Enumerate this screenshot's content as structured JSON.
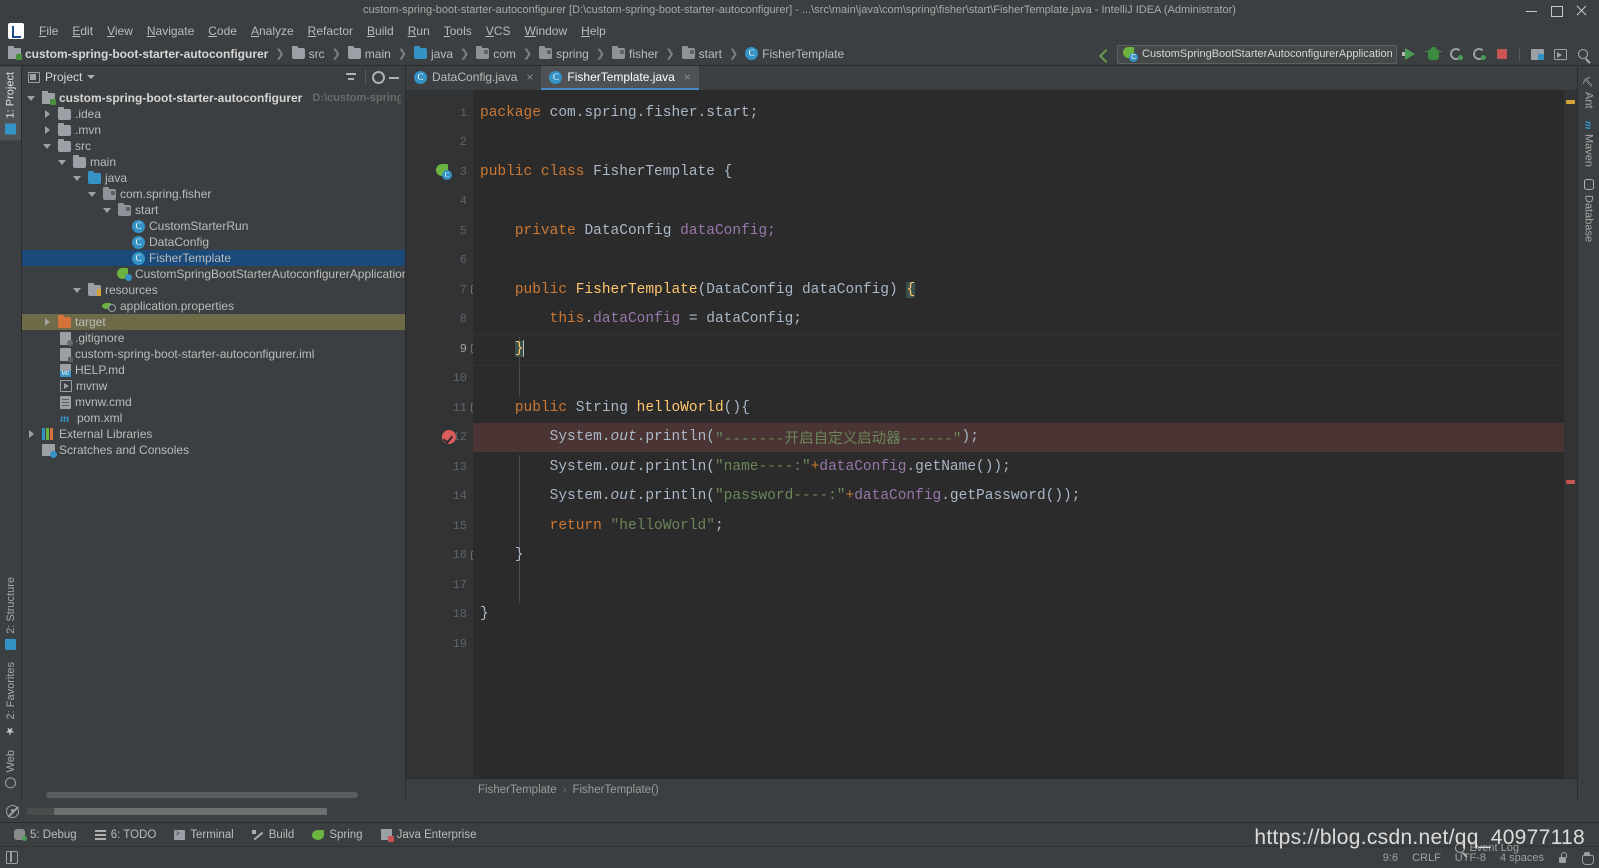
{
  "window": {
    "title": "custom-spring-boot-starter-autoconfigurer [D:\\custom-spring-boot-starter-autoconfigurer] - ...\\src\\main\\java\\com\\spring\\fisher\\start\\FisherTemplate.java - IntelliJ IDEA (Administrator)",
    "minimize_label": "–",
    "maximize_label": "□",
    "close_label": "×"
  },
  "menu": {
    "items": [
      {
        "label": "File",
        "mnemonic": "F"
      },
      {
        "label": "Edit",
        "mnemonic": "E"
      },
      {
        "label": "View",
        "mnemonic": "V"
      },
      {
        "label": "Navigate",
        "mnemonic": "N"
      },
      {
        "label": "Code",
        "mnemonic": "C"
      },
      {
        "label": "Analyze",
        "mnemonic": "A"
      },
      {
        "label": "Refactor",
        "mnemonic": "R"
      },
      {
        "label": "Build",
        "mnemonic": "B"
      },
      {
        "label": "Run",
        "mnemonic": "R"
      },
      {
        "label": "Tools",
        "mnemonic": "T"
      },
      {
        "label": "VCS",
        "mnemonic": "V"
      },
      {
        "label": "Window",
        "mnemonic": "W"
      },
      {
        "label": "Help",
        "mnemonic": "H"
      }
    ]
  },
  "navbar": {
    "breadcrumbs": [
      {
        "label": "custom-spring-boot-starter-autoconfigurer",
        "icon": "module-icon",
        "bold": true
      },
      {
        "label": "src",
        "icon": "folder-icon"
      },
      {
        "label": "main",
        "icon": "folder-icon"
      },
      {
        "label": "java",
        "icon": "source-folder-icon"
      },
      {
        "label": "com",
        "icon": "package-icon"
      },
      {
        "label": "spring",
        "icon": "package-icon"
      },
      {
        "label": "fisher",
        "icon": "package-icon"
      },
      {
        "label": "start",
        "icon": "package-icon"
      },
      {
        "label": "FisherTemplate",
        "icon": "class-icon"
      }
    ],
    "run_config": "CustomSpringBootStarterAutoconfigurerApplication",
    "toolbar_icons": [
      "back-arrow-icon",
      "run-icon",
      "debug-icon",
      "run-with-coverage-icon",
      "profile-icon",
      "stop-icon",
      "layout-icon",
      "screen-icon",
      "search-everywhere-icon"
    ]
  },
  "left_strip": {
    "tabs": [
      {
        "label": "1: Project",
        "number": "1",
        "active": true
      },
      {
        "label": "2: Structure",
        "number": "2",
        "active": false
      },
      {
        "label": "2: Favorites",
        "number": "2",
        "active": false
      },
      {
        "label": "Web",
        "number": "",
        "active": false
      }
    ]
  },
  "right_strip": {
    "tabs": [
      {
        "label": "Ant",
        "icon": "ant-icon"
      },
      {
        "label": "Maven",
        "icon": "maven-icon"
      },
      {
        "label": "Database",
        "icon": "database-icon"
      }
    ]
  },
  "project_panel": {
    "title": "Project",
    "actions": [
      "collapse-all-icon",
      "settings-gear-icon",
      "hide-icon"
    ],
    "tree": [
      {
        "label": "custom-spring-boot-starter-autoconfigurer",
        "path": "D:\\custom-spring-boot-start",
        "indent": 0,
        "arrow": "down",
        "icon": "module-icon",
        "bold": true,
        "state": "normal"
      },
      {
        "label": ".idea",
        "indent": 1,
        "arrow": "right",
        "icon": "folder-icon",
        "state": "normal"
      },
      {
        "label": ".mvn",
        "indent": 1,
        "arrow": "right",
        "icon": "folder-icon",
        "state": "normal"
      },
      {
        "label": "src",
        "indent": 1,
        "arrow": "down",
        "icon": "folder-icon",
        "state": "normal"
      },
      {
        "label": "main",
        "indent": 2,
        "arrow": "down",
        "icon": "folder-icon",
        "state": "normal"
      },
      {
        "label": "java",
        "indent": 3,
        "arrow": "down",
        "icon": "source-folder-icon",
        "state": "normal"
      },
      {
        "label": "com.spring.fisher",
        "indent": 4,
        "arrow": "down",
        "icon": "package-icon",
        "state": "normal"
      },
      {
        "label": "start",
        "indent": 5,
        "arrow": "down",
        "icon": "package-icon",
        "state": "normal"
      },
      {
        "label": "CustomStarterRun",
        "indent": 6,
        "arrow": "none",
        "icon": "class-icon",
        "state": "normal"
      },
      {
        "label": "DataConfig",
        "indent": 6,
        "arrow": "none",
        "icon": "class-icon",
        "state": "normal"
      },
      {
        "label": "FisherTemplate",
        "indent": 6,
        "arrow": "none",
        "icon": "class-icon",
        "state": "selected"
      },
      {
        "label": "CustomSpringBootStarterAutoconfigurerApplication",
        "indent": 5,
        "arrow": "none",
        "icon": "spring-app-icon",
        "state": "normal"
      },
      {
        "label": "resources",
        "indent": 3,
        "arrow": "down",
        "icon": "resources-folder-icon",
        "state": "normal"
      },
      {
        "label": "application.properties",
        "indent": 4,
        "arrow": "none",
        "icon": "properties-icon",
        "state": "normal"
      },
      {
        "label": "target",
        "indent": 1,
        "arrow": "right",
        "icon": "excluded-folder-icon",
        "state": "highlighted"
      },
      {
        "label": ".gitignore",
        "indent": 2,
        "arrow": "none",
        "icon": "gitignore-icon",
        "state": "normal"
      },
      {
        "label": "custom-spring-boot-starter-autoconfigurer.iml",
        "indent": 2,
        "arrow": "none",
        "icon": "iml-icon",
        "state": "normal"
      },
      {
        "label": "HELP.md",
        "indent": 2,
        "arrow": "none",
        "icon": "markdown-icon",
        "state": "normal"
      },
      {
        "label": "mvnw",
        "indent": 2,
        "arrow": "none",
        "icon": "executable-icon",
        "state": "normal"
      },
      {
        "label": "mvnw.cmd",
        "indent": 2,
        "arrow": "none",
        "icon": "cmd-file-icon",
        "state": "normal"
      },
      {
        "label": "pom.xml",
        "indent": 2,
        "arrow": "none",
        "icon": "maven-pom-icon",
        "state": "normal"
      },
      {
        "label": "External Libraries",
        "indent": 0,
        "arrow": "right",
        "icon": "libraries-icon",
        "state": "normal"
      },
      {
        "label": "Scratches and Consoles",
        "indent": 0,
        "arrow": "none",
        "icon": "scratches-icon",
        "state": "normal"
      }
    ]
  },
  "editor": {
    "tabs": [
      {
        "label": "DataConfig.java",
        "icon": "class-icon",
        "active": false,
        "close": "×"
      },
      {
        "label": "FisherTemplate.java",
        "icon": "class-icon",
        "active": true,
        "close": "×"
      }
    ],
    "lines": [
      {
        "num": "1",
        "gutter": "",
        "fold": "none",
        "state": "normal"
      },
      {
        "num": "2",
        "gutter": "",
        "fold": "none",
        "state": "normal"
      },
      {
        "num": "3",
        "gutter": "spring-bean-icon",
        "fold": "none",
        "state": "normal"
      },
      {
        "num": "4",
        "gutter": "",
        "fold": "none",
        "state": "normal"
      },
      {
        "num": "5",
        "gutter": "",
        "fold": "none",
        "state": "normal"
      },
      {
        "num": "6",
        "gutter": "",
        "fold": "none",
        "state": "normal"
      },
      {
        "num": "7",
        "gutter": "",
        "fold": "open",
        "state": "normal"
      },
      {
        "num": "8",
        "gutter": "",
        "fold": "none",
        "state": "normal"
      },
      {
        "num": "9",
        "gutter": "",
        "fold": "close",
        "state": "caret"
      },
      {
        "num": "10",
        "gutter": "",
        "fold": "none",
        "state": "normal"
      },
      {
        "num": "11",
        "gutter": "",
        "fold": "open",
        "state": "normal"
      },
      {
        "num": "12",
        "gutter": "breakpoint-verified-icon",
        "fold": "none",
        "state": "breakpoint"
      },
      {
        "num": "13",
        "gutter": "",
        "fold": "none",
        "state": "normal"
      },
      {
        "num": "14",
        "gutter": "",
        "fold": "none",
        "state": "normal"
      },
      {
        "num": "15",
        "gutter": "",
        "fold": "none",
        "state": "normal"
      },
      {
        "num": "16",
        "gutter": "",
        "fold": "close",
        "state": "normal"
      },
      {
        "num": "17",
        "gutter": "",
        "fold": "none",
        "state": "normal"
      },
      {
        "num": "18",
        "gutter": "",
        "fold": "none",
        "state": "normal"
      },
      {
        "num": "19",
        "gutter": "",
        "fold": "none",
        "state": "normal"
      }
    ],
    "code": {
      "l1": "package com.spring.fisher.start;",
      "l3_kw": "public class",
      "l3_name": "FisherTemplate",
      "l3_brace": "{",
      "l5_kw": "private",
      "l5_type": "DataConfig",
      "l5_var": "dataConfig;",
      "l7_kw": "public",
      "l7_name": "FisherTemplate",
      "l7_params": "(DataConfig dataConfig)",
      "l7_brace": "{",
      "l8_this": "this",
      "l8_rest": ".dataConfig = dataConfig;",
      "l8_field": "dataConfig",
      "l9_brace": "}",
      "l11_kw": "public",
      "l11_type": "String",
      "l11_name": "helloWorld",
      "l11_tail": "(){",
      "l12_pre": "System.",
      "l12_out": "out",
      "l12_mid": ".println(",
      "l12_str": "\"-------开启自定义启动器------\"",
      "l12_end": ");",
      "l13_str": "\"name----:\"",
      "l13_plus": "+",
      "l13_field": "dataConfig",
      "l13_call": ".getName());",
      "l14_str": "\"password----:\"",
      "l14_field": "dataConfig",
      "l14_call": ".getPassword());",
      "l15_kw": "return",
      "l15_str": "\"helloWorld\"",
      "l15_end": ";",
      "l16_brace": "}",
      "l18_brace": "}"
    },
    "breadcrumb": [
      "FisherTemplate",
      "FisherTemplate()"
    ],
    "breadcrumb_sep": "›"
  },
  "bottom_tools": {
    "items": [
      {
        "label": "5: Debug",
        "number": "5",
        "icon": "debug-icon"
      },
      {
        "label": "6: TODO",
        "number": "6",
        "icon": "todo-icon"
      },
      {
        "label": "Terminal",
        "number": "",
        "icon": "terminal-icon"
      },
      {
        "label": "Build",
        "number": "",
        "icon": "build-icon"
      },
      {
        "label": "Spring",
        "number": "",
        "icon": "spring-icon"
      },
      {
        "label": "Java Enterprise",
        "number": "",
        "icon": "java-enterprise-icon"
      }
    ]
  },
  "statusbar": {
    "left_icon": "memory-indicator-icon",
    "position": "9:6",
    "line_separator": "CRLF",
    "encoding": "UTF-8",
    "indent": "4 spaces",
    "event_log": "Event Log",
    "lock_icon": "lock-icon",
    "inspector_icon": "inspector-icon"
  },
  "watermark": {
    "text": "https://blog.csdn.net/qq_40977118"
  },
  "colors": {
    "background": "#3c3f41",
    "editor_bg": "#2b2b2b",
    "gutter_bg": "#313335",
    "keyword": "#cc7832",
    "string": "#6a8759",
    "field": "#9876aa",
    "method": "#ffc66d",
    "text": "#a9b7c6",
    "selection": "#1a4a7a",
    "breakpoint_row": "#4b3434",
    "accent": "#4a88c7"
  }
}
